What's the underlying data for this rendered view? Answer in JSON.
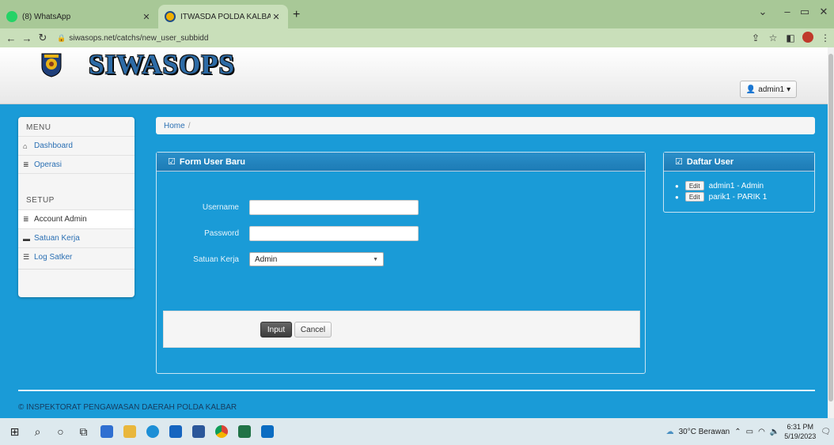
{
  "browser": {
    "tabs": [
      {
        "title": "(8) WhatsApp",
        "favicon": "whatsapp-icon",
        "active": false
      },
      {
        "title": "ITWASDA POLDA KALBAR",
        "favicon": "polda-logo-icon",
        "active": true
      }
    ],
    "new_tab": "+",
    "url": "siwasops.net/catchs/new_user_subbidd"
  },
  "header": {
    "brand": "SIWASOPS",
    "user_button": "admin1"
  },
  "sidebar": {
    "menu_heading": "MENU",
    "menu_items": [
      {
        "label": "Dashboard",
        "icon": "home-icon"
      },
      {
        "label": "Operasi",
        "icon": "list-icon"
      }
    ],
    "setup_heading": "SETUP",
    "setup_items": [
      {
        "label": "Account Admin",
        "icon": "list-icon",
        "active": true
      },
      {
        "label": "Satuan Kerja",
        "icon": "comment-icon",
        "active": false
      },
      {
        "label": "Log Satker",
        "icon": "align-icon",
        "active": false
      }
    ]
  },
  "breadcrumb": {
    "home": "Home",
    "separator": "/"
  },
  "form": {
    "title": "Form User Baru",
    "username_label": "Username",
    "username_value": "",
    "password_label": "Password",
    "password_value": "",
    "satker_label": "Satuan Kerja",
    "satker_value": "Admin",
    "input_button": "Input",
    "cancel_button": "Cancel"
  },
  "user_list": {
    "title": "Daftar User",
    "edit_label": "Edit",
    "users": [
      "admin1 - Admin",
      "parik1 - PARIK 1"
    ]
  },
  "footer": {
    "text": "© INSPEKTORAT PENGAWASAN DAERAH POLDA KALBAR"
  },
  "taskbar": {
    "weather": "30°C Berawan",
    "time": "6:31 PM",
    "date": "5/19/2023"
  },
  "colors": {
    "page_bg": "#1a9bd7",
    "panel_header": "#1d7bb5",
    "link": "#2a6fb3",
    "brand": "#2d6ba6"
  }
}
